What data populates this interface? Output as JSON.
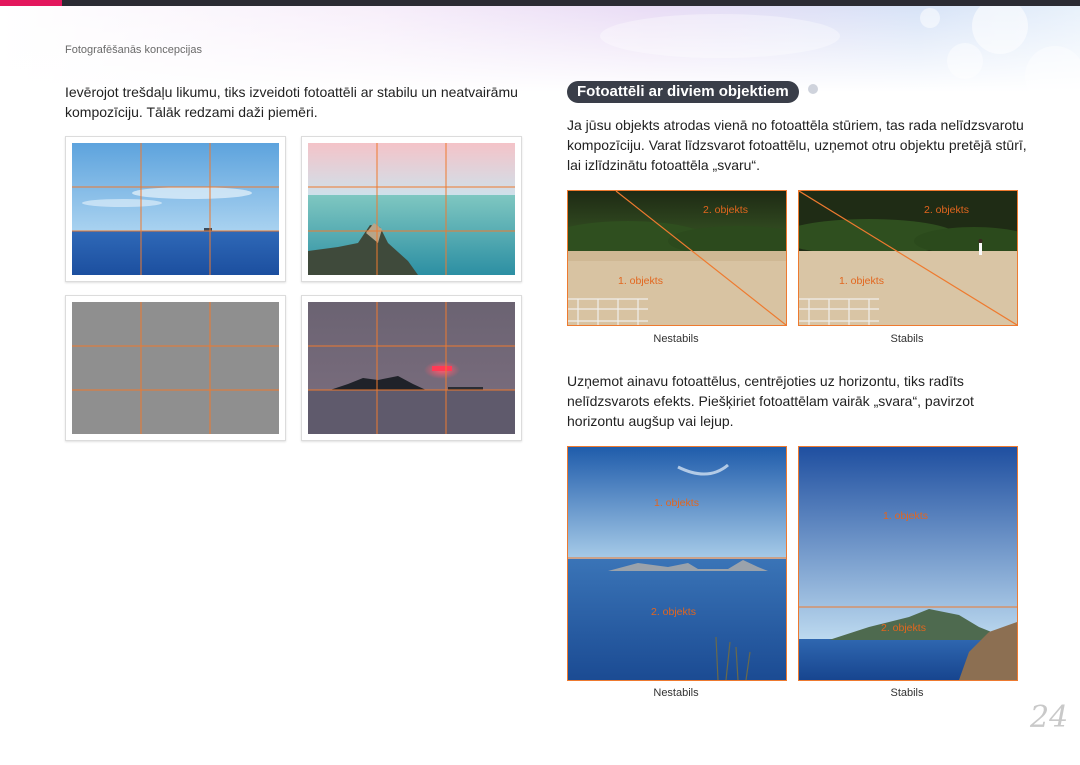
{
  "header": {
    "breadcrumb": "Fotografēšanās koncepcijas"
  },
  "left": {
    "intro_text": "Ievērojot trešdaļu likumu, tiks izveidoti fotoattēli ar stabilu un neatvairāmu kompozīciju. Tālāk redzami daži piemēri."
  },
  "right": {
    "section_title": "Fotoattēli ar diviem objektiem",
    "paragraph1": "Ja jūsu objekts atrodas vienā no fotoattēla stūriem, tas rada nelīdzsvarotu kompozīciju. Varat līdzsvarot fotoattēlu, uzņemot otru objektu pretējā stūrī, lai izlīdzinātu fotoattēla „svaru“.",
    "corner_examples": {
      "object1_label": "1. objekts",
      "object2_label": "2. objekts",
      "caption_left": "Nestabils",
      "caption_right": "Stabils"
    },
    "paragraph2": "Uzņemot ainavu fotoattēlus, centrējoties uz horizontu, tiks radīts nelīdzsvarots efekts. Piešķiriet fotoattēlam vairāk „svara“, pavirzot horizontu augšup vai lejup.",
    "horizon_examples": {
      "object1_label": "1. objekts",
      "object2_label": "2. objekts",
      "caption_left": "Nestabils",
      "caption_right": "Stabils"
    }
  },
  "footer": {
    "page_number": "24"
  },
  "colors": {
    "accent_pink": "#e3175d",
    "grid_orange": "#ee7a2f",
    "heading_bg": "#3a3e49"
  }
}
